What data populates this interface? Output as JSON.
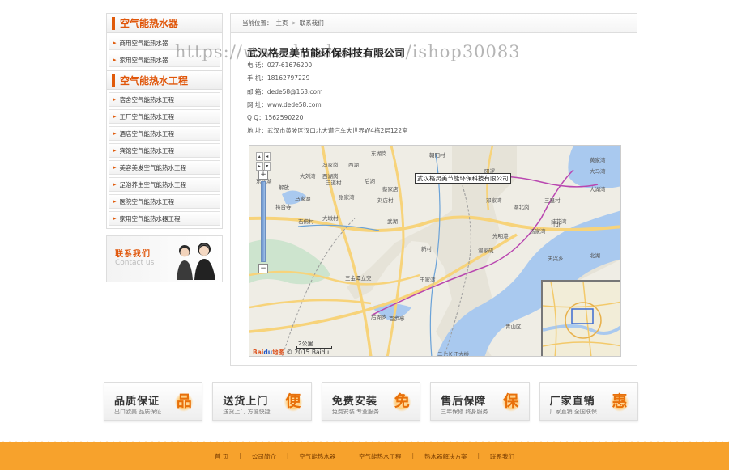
{
  "sidebar": {
    "section1_title": "空气能热水器",
    "section1_items": [
      "商用空气能热水器",
      "家用空气能热水器"
    ],
    "section2_title": "空气能热水工程",
    "section2_items": [
      "宿舍空气能热水工程",
      "工厂空气能热水工程",
      "酒店空气能热水工程",
      "宾馆空气能热水工程",
      "美容美发空气能热水工程",
      "足浴养生空气能热水工程",
      "医院空气能热水工程",
      "家用空气能热水器工程"
    ],
    "contact_cn": "联系我们",
    "contact_en": "Contact us"
  },
  "breadcrumb": {
    "label": "当前位置：",
    "home": "主页",
    "separator": ">",
    "current": "联系我们"
  },
  "company": {
    "name": "武汉格灵美节能环保科技有限公司",
    "phone_label": "电 话：",
    "phone": "027-61676200",
    "mobile_label": "手 机：",
    "mobile": "18162797229",
    "email_label": "邮 箱：",
    "email": "dede58@163.com",
    "url_label": "网 址：",
    "url": "www.dede58.com",
    "qq_label": "Q Q：",
    "qq": "1562590220",
    "address_label": "地 址：",
    "address": "武汉市黄陂区汉口北大道汽车大世界W4栋2层122室"
  },
  "watermark": "https://www.huzhan.com/ishop30083",
  "map": {
    "marker_label": "武汉格灵美节能环保科技有限公司",
    "scale_label": "2公里",
    "copyright": "© 2015 Baidu",
    "logo_a": "Bai",
    "logo_b": "du",
    "logo_c": "地图",
    "zoom_in": "+",
    "zoom_out": "−",
    "place_labels": [
      "东湖岗",
      "朝阳村",
      "冯家岗",
      "西湖",
      "大刘湾",
      "西湖岗",
      "后湖",
      "马家湖",
      "解放",
      "三道村",
      "蔡家店",
      "刘店村",
      "大丰岗",
      "张家湾",
      "将台寺",
      "武湖",
      "阳逻",
      "黄家湾",
      "大马湾",
      "大湖湾",
      "三里村",
      "桂花湾",
      "江北",
      "石佛村",
      "大墩村",
      "汤家湾",
      "光明港",
      "邓家湾",
      "湖北岗",
      "新村",
      "谌家矶",
      "天兴乡",
      "三金潭立交",
      "王家湾",
      "北湖",
      "百步亭",
      "东西湖",
      "后湖乡",
      "青山区",
      "二七长江大桥"
    ]
  },
  "features": [
    {
      "title": "品质保证",
      "sub": "出口欧美 品质保证",
      "icon": "品"
    },
    {
      "title": "送货上门",
      "sub": "送货上门 方便快捷",
      "icon": "便"
    },
    {
      "title": "免费安装",
      "sub": "免费安装 专业服务",
      "icon": "免"
    },
    {
      "title": "售后保障",
      "sub": "三年保修 终身服务",
      "icon": "保"
    },
    {
      "title": "厂家直销",
      "sub": "厂家直销 全国联保",
      "icon": "惠"
    }
  ],
  "footer": {
    "links": [
      "首 页",
      "公司简介",
      "空气能热水器",
      "空气能热水工程",
      "热水器解决方案",
      "联系我们"
    ]
  },
  "colors": {
    "accent": "#e0560a",
    "footer": "#f7a22c",
    "water": "#a9c9ef",
    "road": "#f7d37a"
  }
}
